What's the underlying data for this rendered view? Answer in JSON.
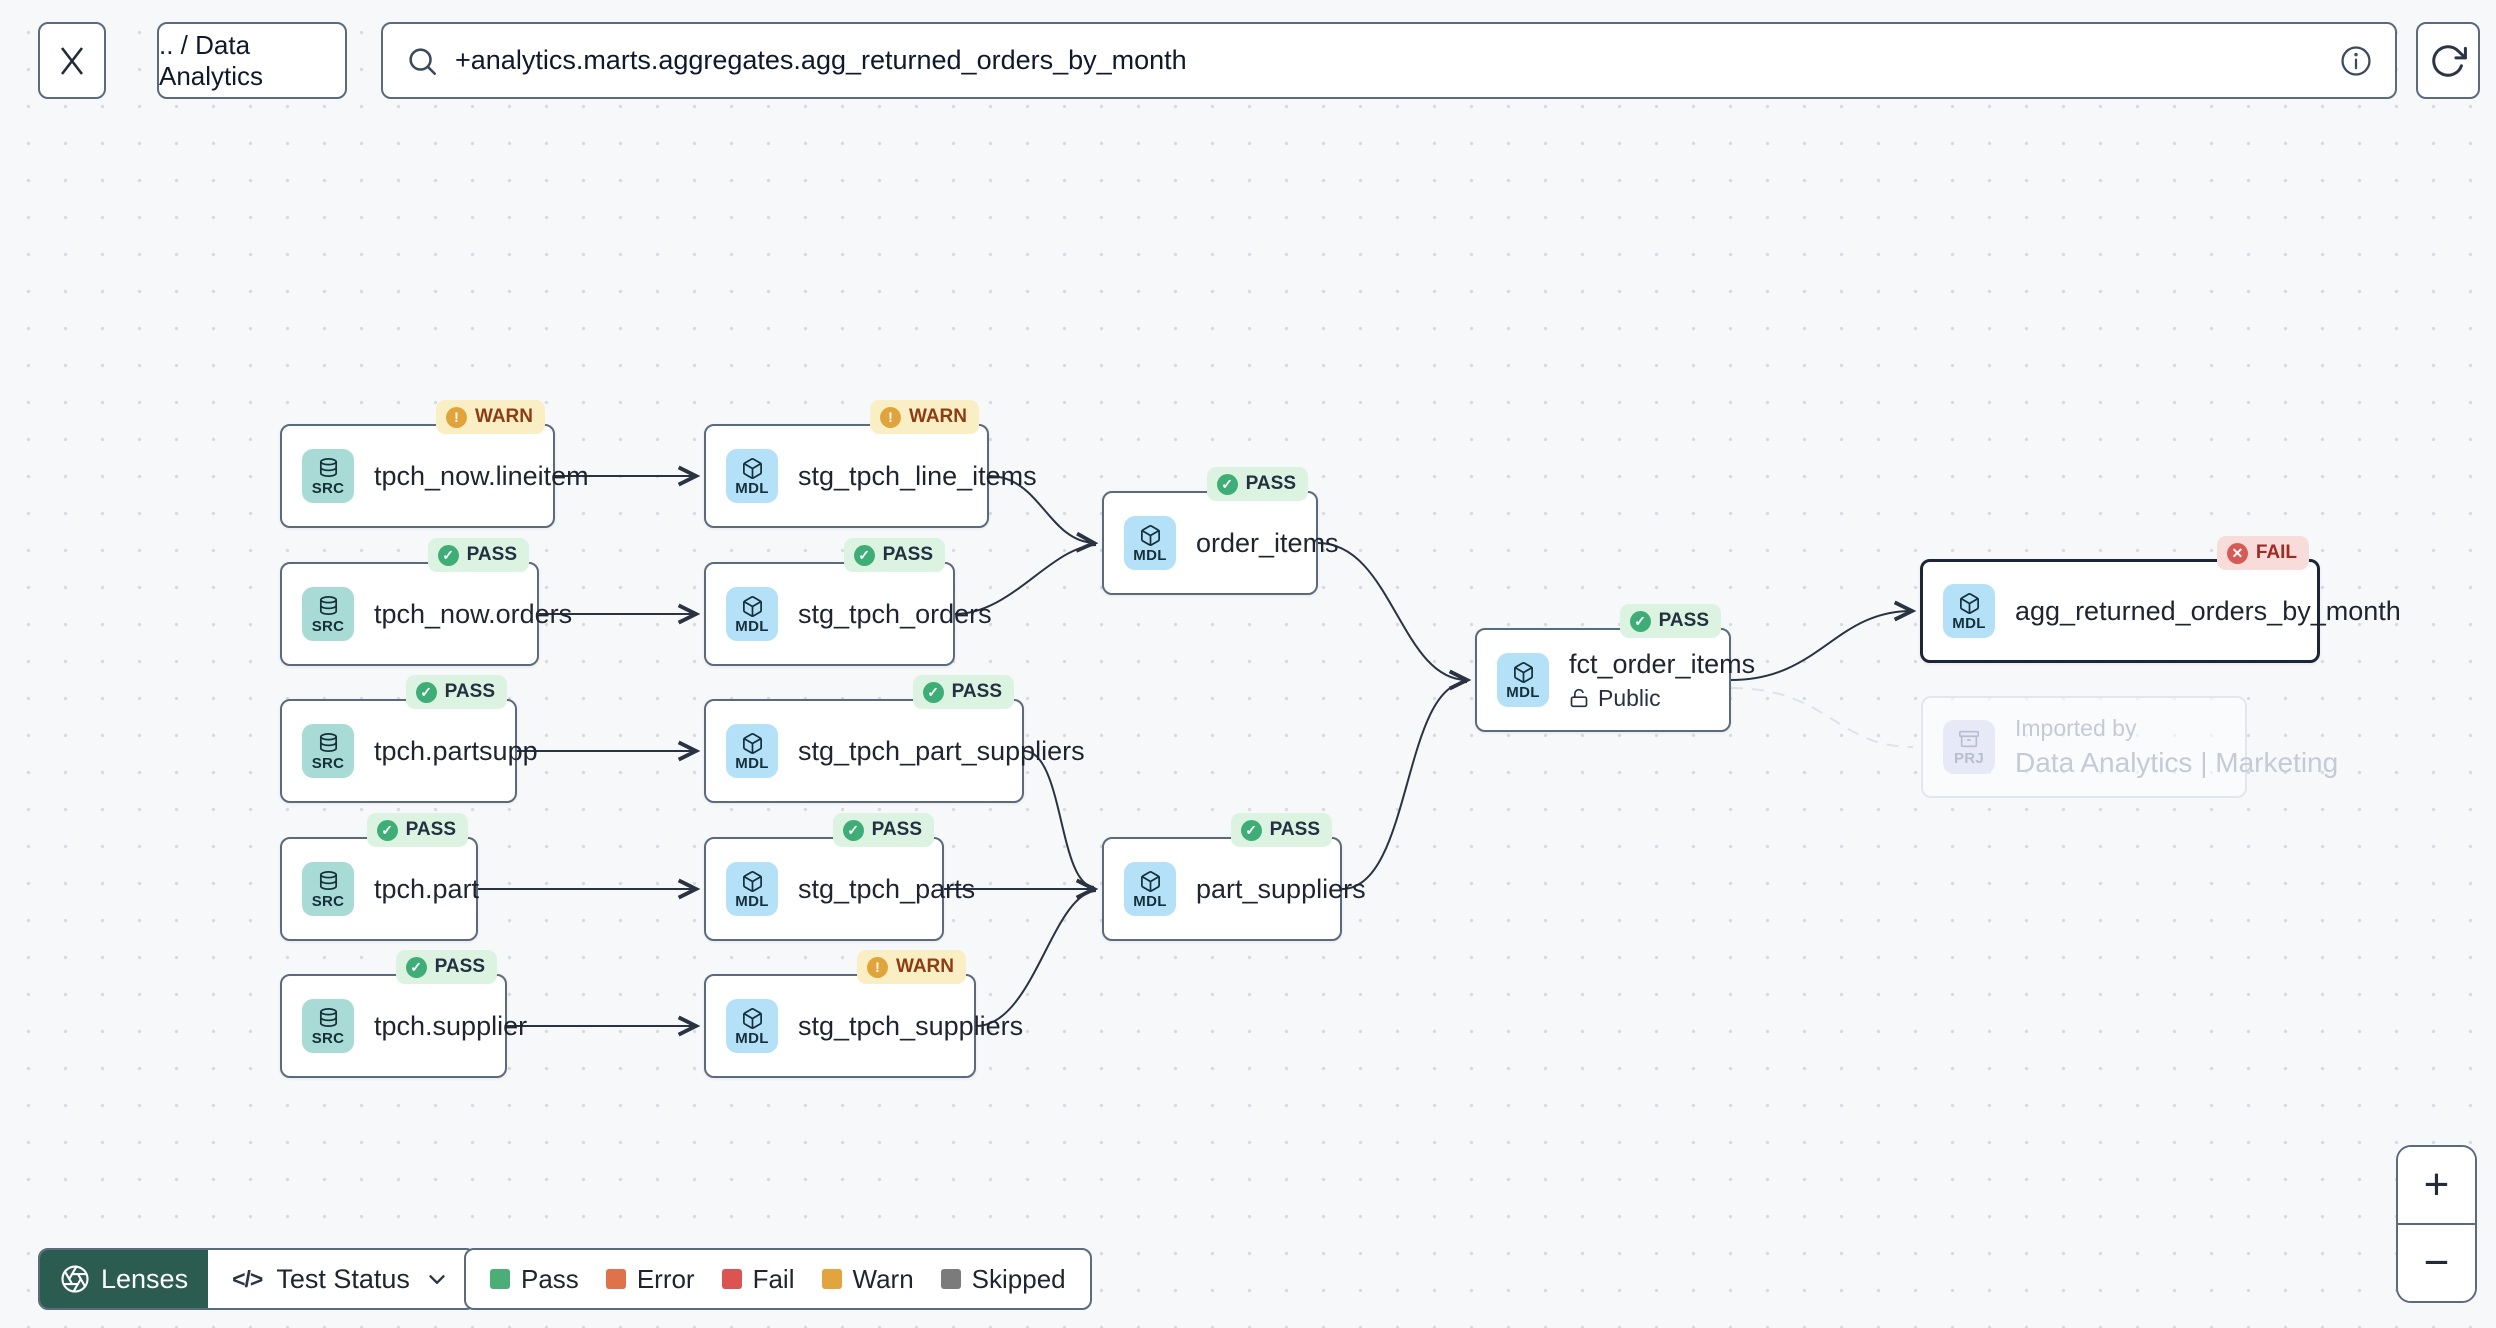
{
  "topbar": {
    "breadcrumb": ".. / Data Analytics",
    "search_value": "+analytics.marts.aggregates.agg_returned_orders_by_month"
  },
  "statuses": {
    "pass": {
      "label": "PASS",
      "glyph": "✓",
      "dot_color": "#3FAD78",
      "bg": "#DCF3E1"
    },
    "warn": {
      "label": "WARN",
      "glyph": "!",
      "dot_color": "#E1A43C",
      "bg": "#FAEEC5"
    },
    "fail": {
      "label": "FAIL",
      "glyph": "✕",
      "dot_color": "#D75B55",
      "bg": "#F8DCDA"
    }
  },
  "graph": {
    "nodes": [
      {
        "label": "tpch_now.lineitem",
        "type": "SRC",
        "status": "WARN"
      },
      {
        "label": "stg_tpch_line_items",
        "type": "MDL",
        "status": "WARN"
      },
      {
        "label": "tpch_now.orders",
        "type": "SRC",
        "status": "PASS"
      },
      {
        "label": "stg_tpch_orders",
        "type": "MDL",
        "status": "PASS"
      },
      {
        "label": "order_items",
        "type": "MDL",
        "status": "PASS"
      },
      {
        "label": "tpch.partsupp",
        "type": "SRC",
        "status": "PASS"
      },
      {
        "label": "stg_tpch_part_suppliers",
        "type": "MDL",
        "status": "PASS"
      },
      {
        "label": "fct_order_items",
        "type": "MDL",
        "status": "PASS",
        "access": "Public"
      },
      {
        "label": "agg_returned_orders_by_month",
        "type": "MDL",
        "status": "FAIL",
        "selected": true
      },
      {
        "label": "tpch.part",
        "type": "SRC",
        "status": "PASS"
      },
      {
        "label": "stg_tpch_parts",
        "type": "MDL",
        "status": "PASS"
      },
      {
        "label": "part_suppliers",
        "type": "MDL",
        "status": "PASS"
      },
      {
        "label": "tpch.supplier",
        "type": "SRC",
        "status": "PASS"
      },
      {
        "label": "stg_tpch_suppliers",
        "type": "MDL",
        "status": "WARN"
      },
      {
        "type": "PRJ",
        "line1": "Imported by",
        "line2": "Data Analytics | Marketing"
      }
    ]
  },
  "toolbar": {
    "lenses_label": "Lenses",
    "lens_icon": "</>",
    "lens_value": "Test Status",
    "legend": [
      {
        "label": "Pass",
        "color": "#4CAE77"
      },
      {
        "label": "Error",
        "color": "#E0724B"
      },
      {
        "label": "Fail",
        "color": "#DC5452"
      },
      {
        "label": "Warn",
        "color": "#E2A43C"
      },
      {
        "label": "Skipped",
        "color": "#7B7B7B"
      }
    ]
  },
  "zoom_controls": {
    "zoom_in": "+",
    "zoom_out": "−"
  },
  "colors": {
    "canvas_bg": "#F7F8FA",
    "node_border": "#5C6A7D",
    "selected_border": "#1C2636",
    "edge": "#2A3342",
    "edge_faded": "#DFE2E9",
    "chip_src_bg": "#A8DBD5",
    "chip_mdl_bg": "#B4E0F8",
    "chip_prj_bg": "#E7E9F6",
    "lenses_bg": "#2C5B4F"
  }
}
